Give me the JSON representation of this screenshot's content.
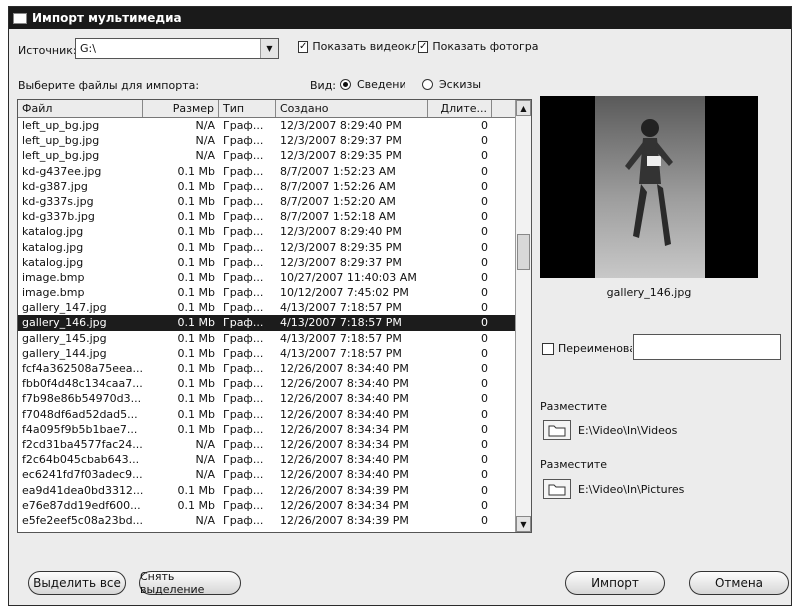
{
  "window": {
    "title": "Импорт мультимедиа"
  },
  "source": {
    "label": "Источник:",
    "value": "G:\\"
  },
  "checks": {
    "videos": "Показать видеоклипы",
    "photos": "Показать фотографии"
  },
  "files_label": "Выберите файлы для импорта:",
  "view": {
    "label": "Вид:",
    "detail": "Сведения",
    "thumbs": "Эскизы",
    "selected": "detail"
  },
  "columns": [
    "Файл",
    "Размер",
    "Тип",
    "Создано",
    "Длите..."
  ],
  "rows": [
    [
      "left_up_bg.jpg",
      "N/A",
      "Граф...",
      "12/3/2007 8:29:40 PM",
      "0"
    ],
    [
      "left_up_bg.jpg",
      "N/A",
      "Граф...",
      "12/3/2007 8:29:37 PM",
      "0"
    ],
    [
      "left_up_bg.jpg",
      "N/A",
      "Граф...",
      "12/3/2007 8:29:35 PM",
      "0"
    ],
    [
      "kd-g437ee.jpg",
      "0.1 Mb",
      "Граф...",
      "8/7/2007 1:52:23 AM",
      "0"
    ],
    [
      "kd-g387.jpg",
      "0.1 Mb",
      "Граф...",
      "8/7/2007 1:52:26 AM",
      "0"
    ],
    [
      "kd-g337s.jpg",
      "0.1 Mb",
      "Граф...",
      "8/7/2007 1:52:20 AM",
      "0"
    ],
    [
      "kd-g337b.jpg",
      "0.1 Mb",
      "Граф...",
      "8/7/2007 1:52:18 AM",
      "0"
    ],
    [
      "katalog.jpg",
      "0.1 Mb",
      "Граф...",
      "12/3/2007 8:29:40 PM",
      "0"
    ],
    [
      "katalog.jpg",
      "0.1 Mb",
      "Граф...",
      "12/3/2007 8:29:35 PM",
      "0"
    ],
    [
      "katalog.jpg",
      "0.1 Mb",
      "Граф...",
      "12/3/2007 8:29:37 PM",
      "0"
    ],
    [
      "image.bmp",
      "0.1 Mb",
      "Граф...",
      "10/27/2007 11:40:03 AM",
      "0"
    ],
    [
      "image.bmp",
      "0.1 Mb",
      "Граф...",
      "10/12/2007 7:45:02 PM",
      "0"
    ],
    [
      "gallery_147.jpg",
      "0.1 Mb",
      "Граф...",
      "4/13/2007 7:18:57 PM",
      "0"
    ],
    [
      "gallery_146.jpg",
      "0.1 Mb",
      "Граф...",
      "4/13/2007 7:18:57 PM",
      "0"
    ],
    [
      "gallery_145.jpg",
      "0.1 Mb",
      "Граф...",
      "4/13/2007 7:18:57 PM",
      "0"
    ],
    [
      "gallery_144.jpg",
      "0.1 Mb",
      "Граф...",
      "4/13/2007 7:18:57 PM",
      "0"
    ],
    [
      "fcf4a362508a75eea...",
      "0.1 Mb",
      "Граф...",
      "12/26/2007 8:34:40 PM",
      "0"
    ],
    [
      "fbb0f4d48c134caa7...",
      "0.1 Mb",
      "Граф...",
      "12/26/2007 8:34:40 PM",
      "0"
    ],
    [
      "f7b98e86b54970d3...",
      "0.1 Mb",
      "Граф...",
      "12/26/2007 8:34:40 PM",
      "0"
    ],
    [
      "f7048df6ad52dad5...",
      "0.1 Mb",
      "Граф...",
      "12/26/2007 8:34:40 PM",
      "0"
    ],
    [
      "f4a095f9b5b1bae7...",
      "0.1 Mb",
      "Граф...",
      "12/26/2007 8:34:34 PM",
      "0"
    ],
    [
      "f2cd31ba4577fac24...",
      "N/A",
      "Граф...",
      "12/26/2007 8:34:34 PM",
      "0"
    ],
    [
      "f2c64b045cbab643...",
      "N/A",
      "Граф...",
      "12/26/2007 8:34:40 PM",
      "0"
    ],
    [
      "ec6241fd7f03adec9...",
      "N/A",
      "Граф...",
      "12/26/2007 8:34:40 PM",
      "0"
    ],
    [
      "ea9d41dea0bd3312...",
      "0.1 Mb",
      "Граф...",
      "12/26/2007 8:34:39 PM",
      "0"
    ],
    [
      "e76e87dd19edf600...",
      "0.1 Mb",
      "Граф...",
      "12/26/2007 8:34:34 PM",
      "0"
    ],
    [
      "e5fe2eef5c08a23bd...",
      "N/A",
      "Граф...",
      "12/26/2007 8:34:39 PM",
      "0"
    ]
  ],
  "selected_row": 13,
  "preview": {
    "name": "gallery_146.jpg"
  },
  "rename": {
    "label": "Переименовать",
    "value": ""
  },
  "places": [
    {
      "label": "Разместите",
      "path": "E:\\Video\\In\\Videos"
    },
    {
      "label": "Разместите",
      "path": "E:\\Video\\In\\Pictures"
    }
  ],
  "buttons": {
    "select_all": "Выделить все",
    "deselect": "Снять выделение",
    "import": "Импорт",
    "cancel": "Отмена"
  },
  "icons": {
    "folder": "folder-icon",
    "check": "check-icon",
    "arrow_up": "arrow-up-icon",
    "arrow_down": "arrow-down-icon"
  }
}
